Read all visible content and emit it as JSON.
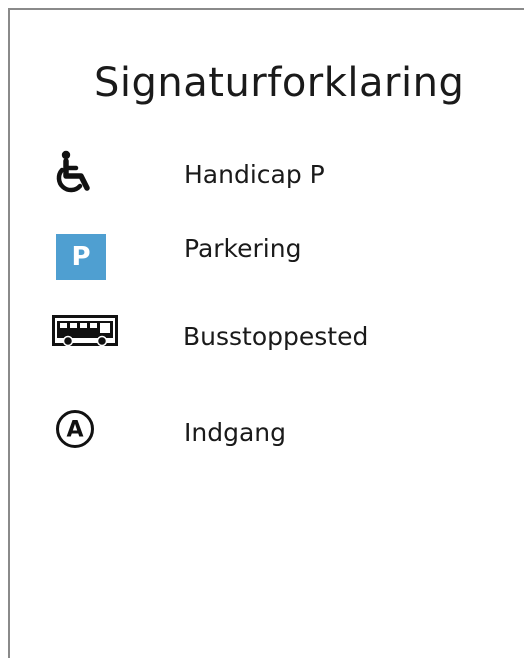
{
  "legend": {
    "title": "Signaturforklaring",
    "items": [
      {
        "icon": "wheelchair-icon",
        "label": "Handicap P"
      },
      {
        "icon": "parking-icon",
        "icon_text": "P",
        "label": "Parkering"
      },
      {
        "icon": "bus-icon",
        "label": "Busstoppested"
      },
      {
        "icon": "entrance-a-icon",
        "icon_text": "A",
        "label": "Indgang"
      }
    ]
  },
  "colors": {
    "parking_blue": "#4f9fd1",
    "text": "#1a1a1a",
    "border": "#8a8a8a"
  }
}
